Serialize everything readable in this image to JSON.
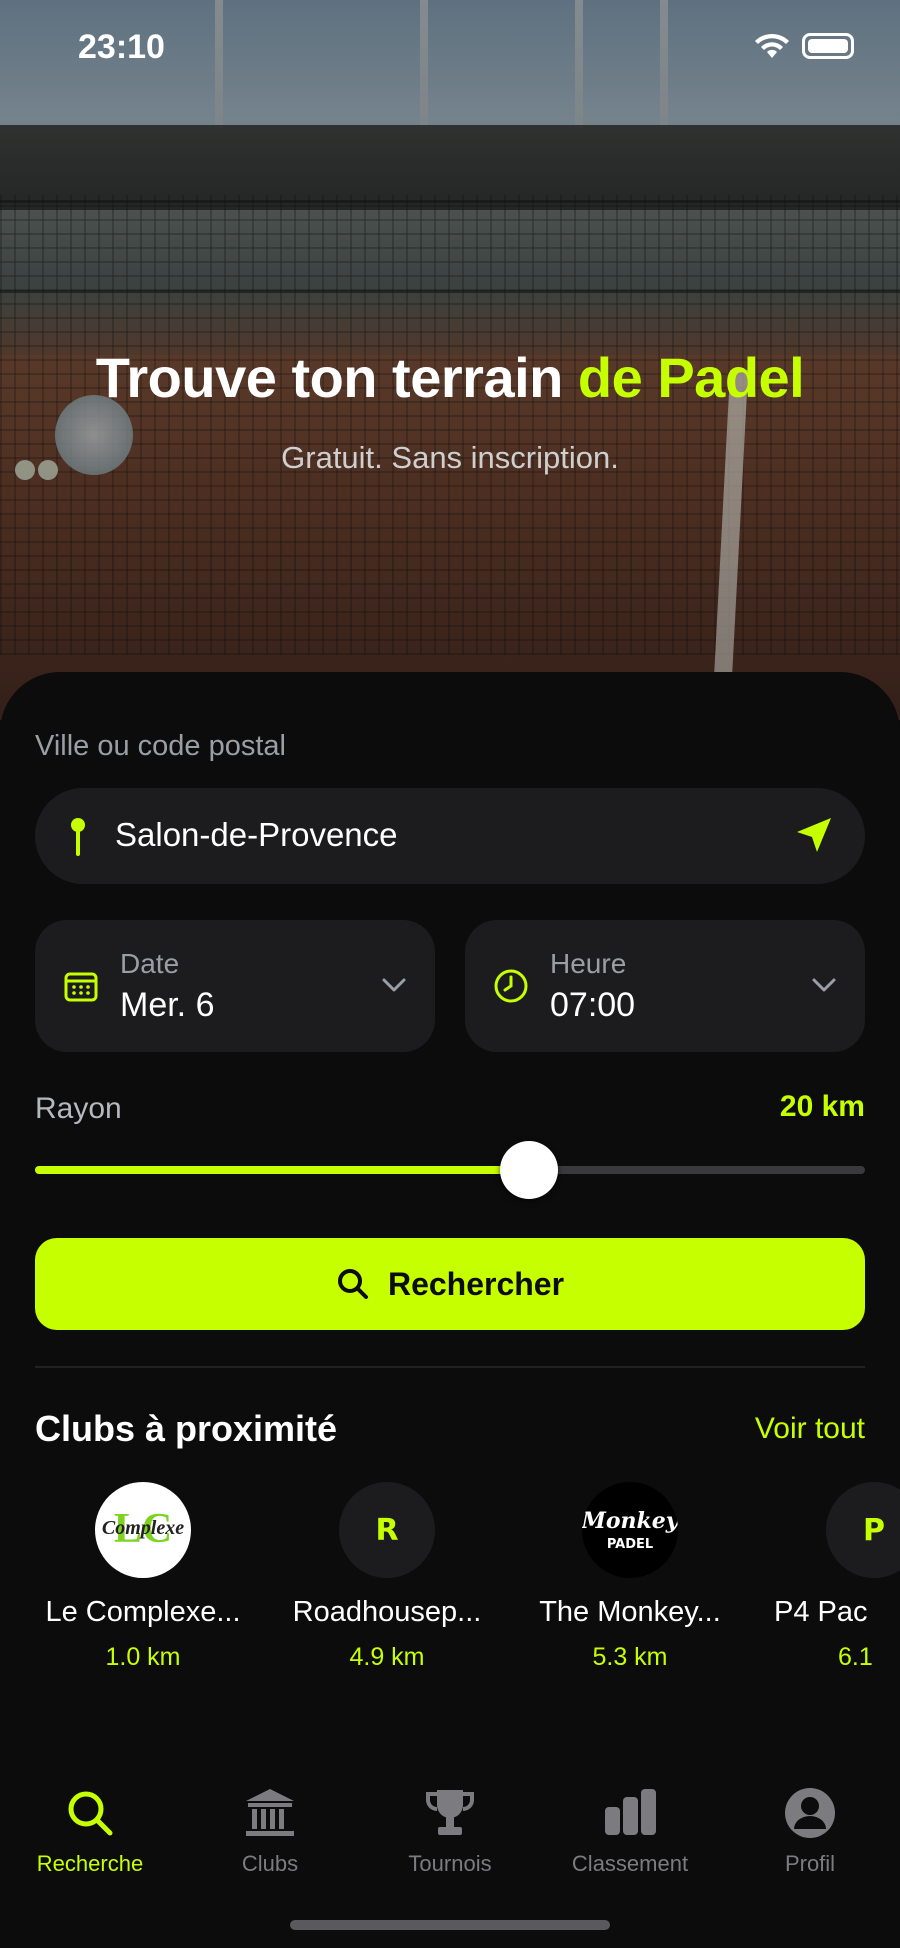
{
  "status": {
    "time": "23:10"
  },
  "hero": {
    "title_main": "Trouve ton terrain ",
    "title_accent": "de Padel",
    "subtitle": "Gratuit. Sans inscription."
  },
  "search": {
    "location_label": "Ville ou code postal",
    "location_value": "Salon-de-Provence",
    "date_label": "Date",
    "date_value": "Mer. 6",
    "time_label": "Heure",
    "time_value": "07:00",
    "radius_label": "Rayon",
    "radius_value": "20 km",
    "radius_fraction": 0.595,
    "button_label": "Rechercher"
  },
  "clubs": {
    "title": "Clubs à proximité",
    "see_all": "Voir tout",
    "items": [
      {
        "name": "Le Complexe...",
        "distance": "1.0 km",
        "initial": ""
      },
      {
        "name": "Roadhousep...",
        "distance": "4.9 km",
        "initial": "R"
      },
      {
        "name": "The Monkey...",
        "distance": "5.3 km",
        "initial": ""
      },
      {
        "name": "P4 Pac",
        "distance": "6.1",
        "initial": "P"
      }
    ]
  },
  "tabs": [
    {
      "label": "Recherche",
      "icon": "search-icon",
      "active": true
    },
    {
      "label": "Clubs",
      "icon": "building-icon",
      "active": false
    },
    {
      "label": "Tournois",
      "icon": "trophy-icon",
      "active": false
    },
    {
      "label": "Classement",
      "icon": "bar-chart-icon",
      "active": false
    },
    {
      "label": "Profil",
      "icon": "user-icon",
      "active": false
    }
  ],
  "colors": {
    "accent": "#c6ff00",
    "background": "#0c0c0c",
    "surface": "#1c1c1e"
  }
}
